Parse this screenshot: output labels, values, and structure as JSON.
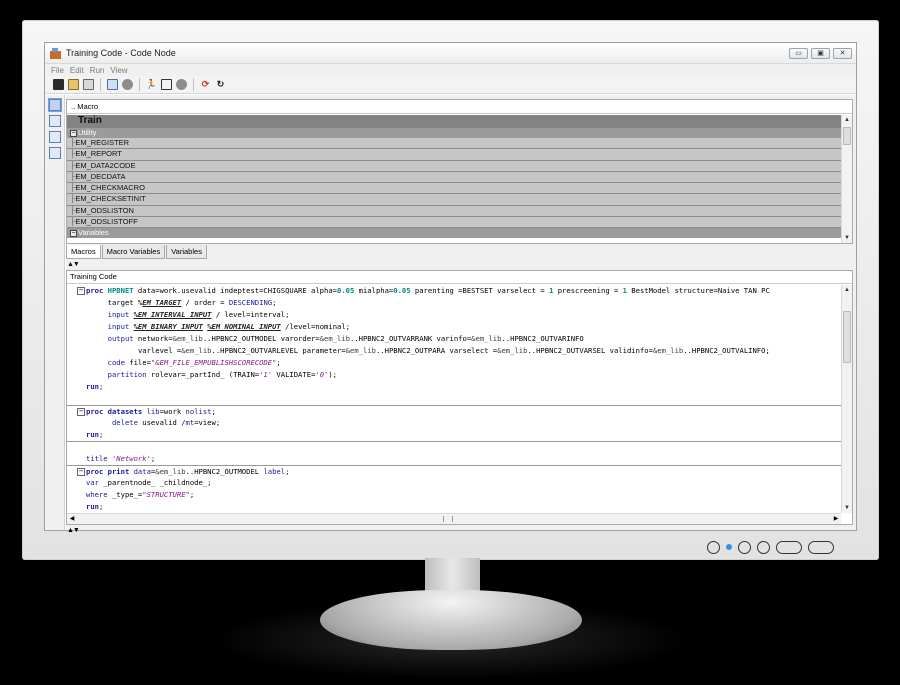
{
  "window": {
    "title": "Training Code - Code Node",
    "btn_min": "▭",
    "btn_max": "▣",
    "btn_close": "✕"
  },
  "menu": [
    "File",
    "Edit",
    "Run",
    "View"
  ],
  "toolbar_icons": [
    "save-icon",
    "export-icon",
    "print-icon",
    "edit-icon",
    "record-icon",
    "run-icon",
    "results-icon",
    "stop-icon",
    "refresh-icon",
    "reset-icon"
  ],
  "macro_panel": {
    "header": ".. Macro",
    "root": "Train",
    "group_utility": "Utility",
    "items": [
      "EM_REGISTER",
      "EM_REPORT",
      "EM_DATA2CODE",
      "EM_DECDATA",
      "EM_CHECKMACRO",
      "EM_CHECKSETINIT",
      "EM_ODSLISTON",
      "EM_ODSLISTOFF"
    ],
    "group_variables": "Variables"
  },
  "tabs": [
    "Macros",
    "Macro Variables",
    "Variables"
  ],
  "code_panel": {
    "header": "Training Code"
  },
  "code": {
    "l1_proc": "proc",
    "l1_name": "HPBNET",
    "l1_a": " data=work.usevalid indeptest=CHIGSQUARE alpha=",
    "l1_alpha": "0.05",
    "l1_b": " mialpha=",
    "l1_mialpha": "0.05",
    "l1_c": " parenting =BESTSET varselect = ",
    "l1_one": "1",
    "l1_d": " prescreening = ",
    "l1_one2": "1",
    "l1_e": " BestModel structure=Naive TAN PC",
    "l2_target": "target",
    "l2_pct": " %",
    "l2_mac": "EM_TARGET",
    "l2_a": " / order = ",
    "l2_kw": "DESCENDING",
    "l2_end": ";",
    "l3_input": "input",
    "l3_mac": "%EM_INTERVAL_INPUT",
    "l3_a": " / level=interval;",
    "l4_input": "input",
    "l4_mac1": "%EM_BINARY_INPUT",
    "l4_mac2": "%EM_NOMINAL_INPUT",
    "l4_a": " /level=nominal;",
    "l5_output": "output",
    "l5_a": " network=",
    "l5_r1": "&em_lib",
    "l5_b": "..HPBNC2_OUTMODEL varorder=",
    "l5_r2": "&em_lib",
    "l5_c": "..HPBNC2_OUTVARRANK varinfo=",
    "l5_r3": "&em_lib",
    "l5_d": "..HPBNC2_OUTVARINFO",
    "l6_a": "varlevel =",
    "l6_r1": "&em_lib",
    "l6_b": "..HPBNC2_OUTVARLEVEL parameter=",
    "l6_r2": "&em_lib",
    "l6_c": "..HPBNC2_OUTPARA varselect =",
    "l6_r3": "&em_lib",
    "l6_d": "..HPBNC2_OUTVARSEL validinfo=",
    "l6_r4": "&em_lib",
    "l6_e": "..HPBNC2_OUTVALINFO;",
    "l7_code": "code",
    "l7_a": " file=",
    "l7_str": "\"&EM_FILE_EMPUBLISHSCORECODE\"",
    "l7_end": ";",
    "l8_part": "partition",
    "l8_a": " rolevar=_partInd_ (TRAIN=",
    "l8_s1": "'1'",
    "l8_b": " VALIDATE=",
    "l8_s2": "'0'",
    "l8_end": ");",
    "l9_run": "run",
    "l9_end": ";",
    "l10_blank": "",
    "l11_proc": "proc",
    "l11_name": "datasets",
    "l11_lib": " lib",
    "l11_a": "=work ",
    "l11_nolist": "nolist",
    "l11_end": ";",
    "l12_delete": "delete",
    "l12_a": " usevalid /",
    "l12_mt": "mt",
    "l12_b": "=view;",
    "l13_run": "run",
    "l13_end": ";",
    "l14_blank": "",
    "l15_title": "title",
    "l15_str": "'Network'",
    "l15_end": ";",
    "l16_proc": "proc",
    "l16_name": "print",
    "l16_data": " data",
    "l16_a": "=",
    "l16_r": "&em_lib",
    "l16_b": "..HPBNC2_OUTMODEL ",
    "l16_label": "label",
    "l16_end": ";",
    "l17_var": "var",
    "l17_a": " _parentnode_ _childnode_;",
    "l18_where": "where",
    "l18_a": " _type_=",
    "l18_str": "\"STRUCTURE\"",
    "l18_end": ";",
    "l19_run": "run",
    "l19_end": ";"
  },
  "splitter": "▲▼"
}
